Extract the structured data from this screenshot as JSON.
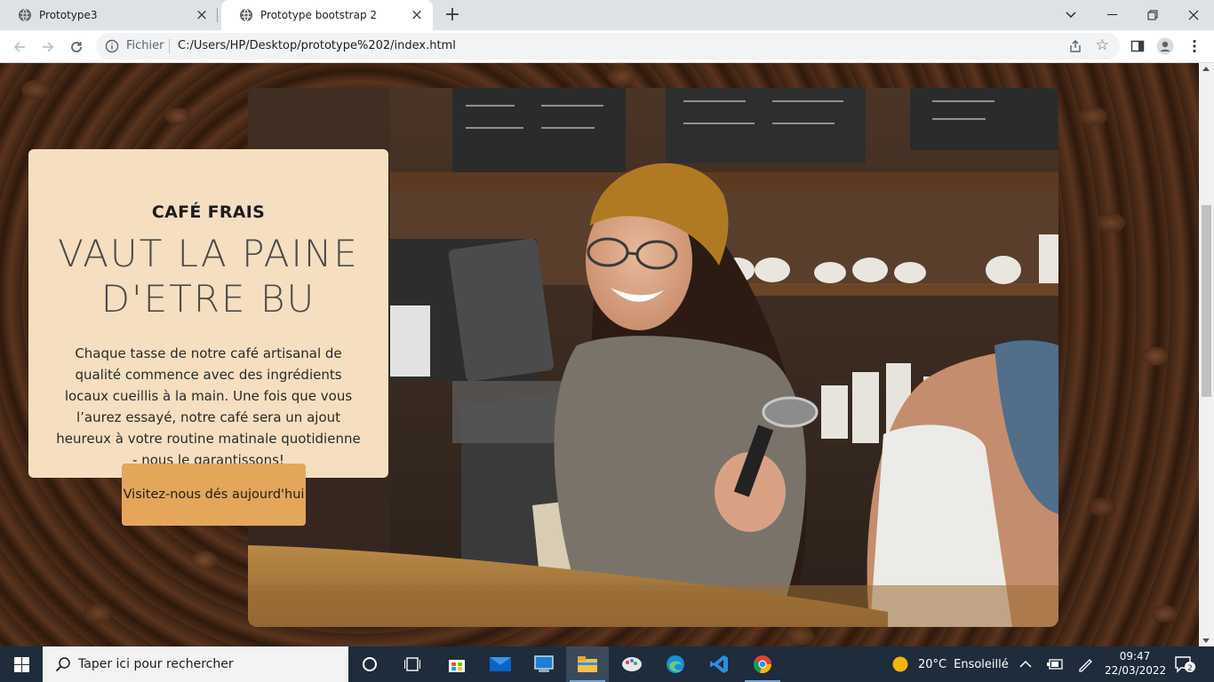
{
  "browser": {
    "tabs": [
      {
        "title": "Prototype3",
        "active": false
      },
      {
        "title": "Prototype bootstrap 2",
        "active": true
      }
    ],
    "address": {
      "scheme_label": "Fichier",
      "url": "C:/Users/HP/Desktop/prototype%202/index.html"
    }
  },
  "hero": {
    "subtitle": "CAFÉ FRAIS",
    "headline_line1": "VAUT LA PAINE",
    "headline_line2": "D'ETRE BU",
    "paragraph": "Chaque tasse de notre café artisanal de qualité commence avec des ingrédients locaux cueillis à la main. Une fois que vous l’aurez essayé, notre café sera un ajout heureux à votre routine matinale quotidienne - nous le garantissons!",
    "cta_label": "Visitez-nous dés aujourd'hui"
  },
  "colors": {
    "card_bg": "#f5dfc0",
    "cta_bg": "#e3a65a",
    "taskbar_bg": "#1e2c3b"
  },
  "taskbar": {
    "search_placeholder": "Taper ici pour rechercher",
    "weather": {
      "temp": "20°C",
      "condition": "Ensoleillé"
    },
    "clock": {
      "time": "09:47",
      "date": "22/03/2022"
    },
    "notification_count": "2"
  }
}
